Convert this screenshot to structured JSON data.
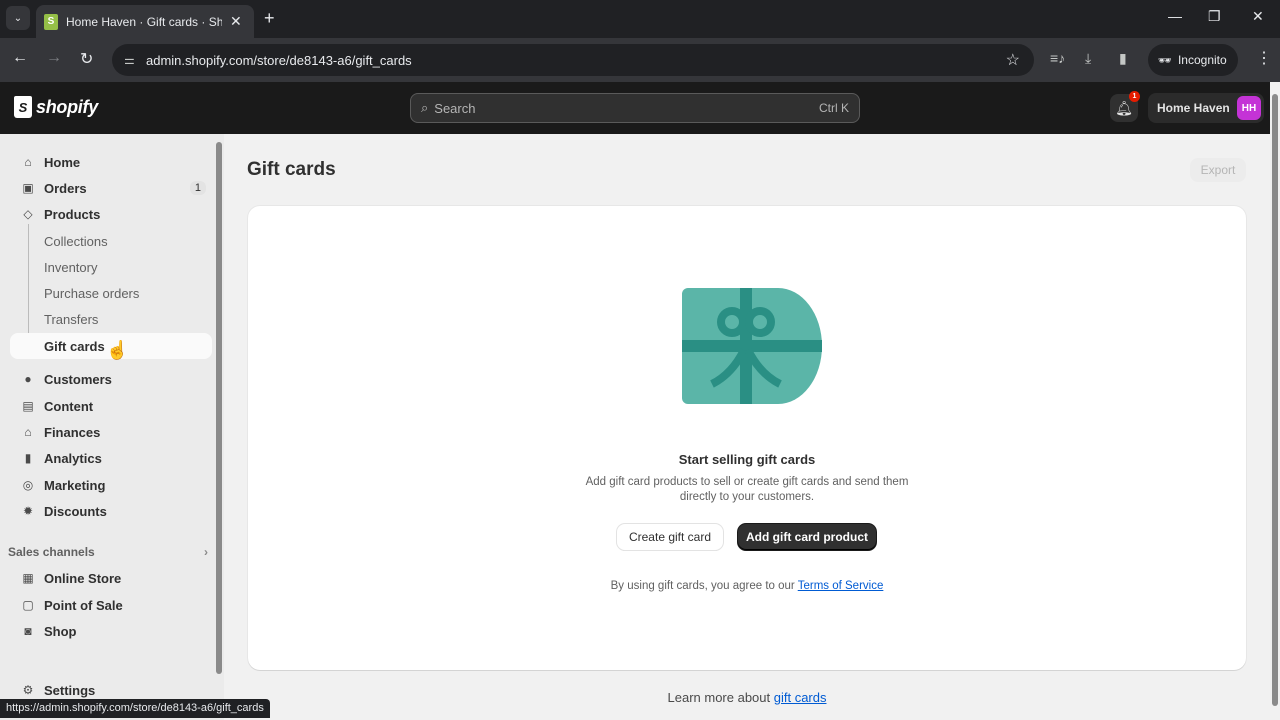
{
  "browser": {
    "tab_title": "Home Haven · Gift cards · Shop",
    "tab_close": "✕",
    "new_tab": "+",
    "url": "admin.shopify.com/store/de8143-a6/gift_cards",
    "incognito_label": "Incognito",
    "status_url": "https://admin.shopify.com/store/de8143-a6/gift_cards",
    "icons": {
      "tab_list": "⌄",
      "back": "←",
      "forward": "→",
      "reload": "↻",
      "site_info": "⚌",
      "star": "☆",
      "media": "≡♪",
      "download": "⤓",
      "sidepanel": "▮",
      "incognito": "🕶",
      "menu": "⋮",
      "minimize": "—",
      "restore": "❐",
      "close": "✕"
    }
  },
  "topbar": {
    "logo_text": "shopify",
    "search_placeholder": "Search",
    "search_shortcut": "Ctrl K",
    "notification_count": "1",
    "store_name": "Home Haven",
    "avatar_initials": "HH",
    "avatar_color": "#c433d6"
  },
  "sidebar": {
    "items": [
      {
        "label": "Home",
        "icon": "⌂"
      },
      {
        "label": "Orders",
        "icon": "▣",
        "count": "1"
      },
      {
        "label": "Products",
        "icon": "◇"
      },
      {
        "label": "Collections"
      },
      {
        "label": "Inventory"
      },
      {
        "label": "Purchase orders"
      },
      {
        "label": "Transfers"
      },
      {
        "label": "Gift cards"
      },
      {
        "label": "Customers",
        "icon": "●"
      },
      {
        "label": "Content",
        "icon": "▤"
      },
      {
        "label": "Finances",
        "icon": "⌂"
      },
      {
        "label": "Analytics",
        "icon": "▮"
      },
      {
        "label": "Marketing",
        "icon": "◎"
      },
      {
        "label": "Discounts",
        "icon": "✹"
      }
    ],
    "sales_channels_label": "Sales channels",
    "sales_channels_chevron": "›",
    "channels": [
      {
        "label": "Online Store",
        "icon": "▦"
      },
      {
        "label": "Point of Sale",
        "icon": "▢"
      },
      {
        "label": "Shop",
        "icon": "◙"
      }
    ],
    "settings_label": "Settings",
    "settings_icon": "⚙"
  },
  "main": {
    "page_title": "Gift cards",
    "export_label": "Export",
    "empty_state": {
      "title": "Start selling gift cards",
      "description": "Add gift card products to sell or create gift cards and send them directly to your customers.",
      "secondary_button": "Create gift card",
      "primary_button": "Add gift card product",
      "terms_prefix": "By using gift cards, you agree to our ",
      "terms_link": "Terms of Service"
    },
    "learn_prefix": "Learn more about ",
    "learn_link": "gift cards",
    "colors": {
      "illustration_card": "#5bb5a8",
      "illustration_ribbon": "#2a8f84",
      "link": "#005bd3",
      "primary_button": "#303030"
    }
  }
}
